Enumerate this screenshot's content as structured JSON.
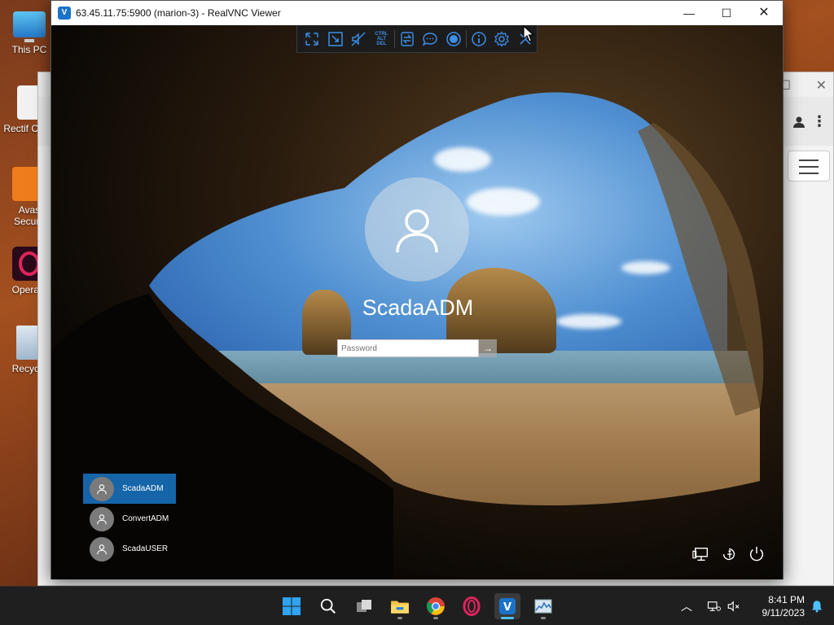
{
  "desktop": {
    "icons": [
      {
        "label": "This PC"
      },
      {
        "label": "Rectif Contr"
      },
      {
        "label": "Avas Secure"
      },
      {
        "label": "OperaG"
      },
      {
        "label": "Recycle"
      }
    ]
  },
  "vnc": {
    "title": "63.45.11.75:5900 (marion-3) - RealVNC Viewer",
    "toolbar": {
      "ctrl_alt_del": "CTRL ALT DEL"
    }
  },
  "login": {
    "username": "ScadaADM",
    "password_placeholder": "Password",
    "users": [
      {
        "name": "ScadaADM",
        "active": true
      },
      {
        "name": "ConvertADM",
        "active": false
      },
      {
        "name": "ScadaUSER",
        "active": false
      }
    ]
  },
  "taskbar": {
    "time": "8:41 PM",
    "date": "9/11/2023"
  },
  "colors": {
    "accent": "#1565a8",
    "vnc_blue": "#3c8ee6",
    "taskbar": "#1f1f1f"
  }
}
